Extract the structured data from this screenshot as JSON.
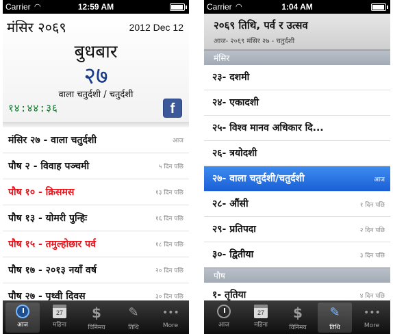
{
  "left_screen": {
    "status": {
      "carrier": "Carrier",
      "time": "12:59 AM"
    },
    "header": {
      "month_year": "मंसिर २०६९",
      "greg_date": "2012 Dec 12",
      "weekday": "बुधबार",
      "day_number": "२७",
      "tithi": "वाला चतुर्दशी / चतुर्दशी",
      "clock": "१४:४४:३६",
      "facebook_label": "f"
    },
    "events": [
      {
        "name": "मंसिर २७ - वाला चतुर्दशी",
        "when": "आज",
        "holiday": false
      },
      {
        "name": "पौष २ - विवाह पञ्चमी",
        "when": "५ दिन पछि",
        "holiday": false
      },
      {
        "name": "पौष १० - क्रिसमस",
        "when": "१३ दिन पछि",
        "holiday": true
      },
      {
        "name": "पौष १३ - योमरी पुन्हिः",
        "when": "१६ दिन पछि",
        "holiday": false
      },
      {
        "name": "पौष १५ - तमुल्होछार पर्व",
        "when": "१८ दिन पछि",
        "holiday": true
      },
      {
        "name": "पौष १७ - २०१३ नयाँ वर्ष",
        "when": "२० दिन पछि",
        "holiday": false
      },
      {
        "name": "पौष २७ - पृथ्वी दिवस",
        "when": "३० दिन पछि",
        "holiday": false
      }
    ],
    "tabs": [
      {
        "label": "आज",
        "icon": "clock-icon",
        "active": true
      },
      {
        "label": "महिना",
        "icon": "calendar-icon",
        "active": false
      },
      {
        "label": "विनिमय",
        "icon": "dollar-icon",
        "active": false
      },
      {
        "label": "तिथि",
        "icon": "pencil-icon",
        "active": false
      },
      {
        "label": "More",
        "icon": "more-icon",
        "active": false
      }
    ]
  },
  "right_screen": {
    "status": {
      "carrier": "Carrier",
      "time": "1:04 AM"
    },
    "header": {
      "title": "२०६९ तिथि, पर्व र उत्सव",
      "subtitle": "आज- २०६९ मंसिर २७ - चतुर्दशी"
    },
    "sections": [
      {
        "title": "मंसिर",
        "rows": [
          {
            "name": "२३- दशमी",
            "when": ""
          },
          {
            "name": "२४- एकादशी",
            "when": ""
          },
          {
            "name": "२५- विश्व मानव अधिकार दि...",
            "when": ""
          },
          {
            "name": "२६- त्रयोदशी",
            "when": ""
          },
          {
            "name": "२७- वाला चतुर्दशी/चतुर्दशी",
            "when": "आज",
            "selected": true
          },
          {
            "name": "२८- औंसी",
            "when": "१ दिन पछि"
          },
          {
            "name": "२९- प्रतिपदा",
            "when": "२ दिन पछि"
          },
          {
            "name": "३०- द्वितीया",
            "when": "३ दिन पछि"
          }
        ]
      },
      {
        "title": "पौष",
        "rows": [
          {
            "name": "१- तृतिया",
            "when": "४ दिन पछि"
          }
        ]
      }
    ],
    "tabs": [
      {
        "label": "आज",
        "icon": "clock-icon",
        "active": false
      },
      {
        "label": "महिना",
        "icon": "calendar-icon",
        "active": false
      },
      {
        "label": "विनिमय",
        "icon": "dollar-icon",
        "active": false
      },
      {
        "label": "तिथि",
        "icon": "pencil-icon",
        "active": true
      },
      {
        "label": "More",
        "icon": "more-icon",
        "active": false
      }
    ],
    "calendar_icon_text": "27"
  }
}
